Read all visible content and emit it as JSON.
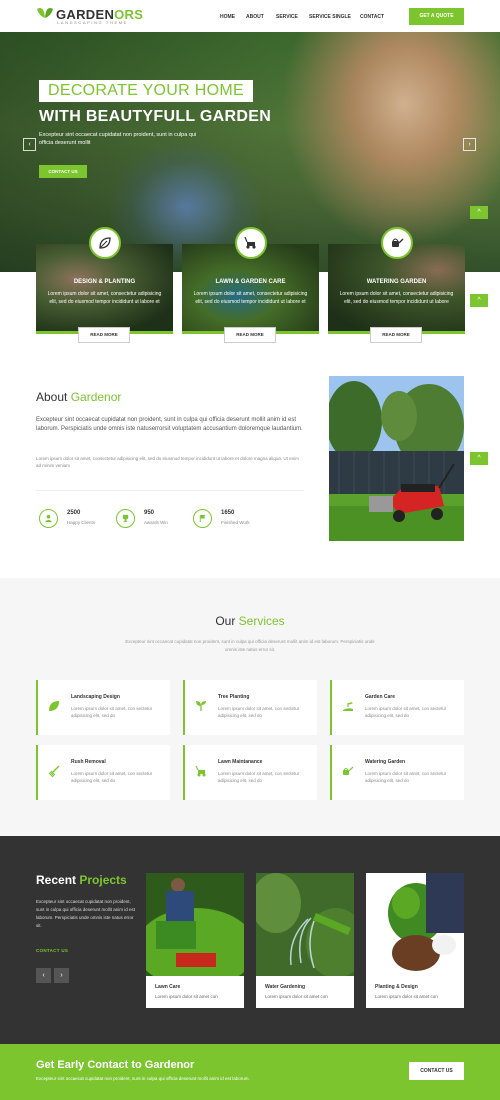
{
  "header": {
    "logo_main": "GARDEN",
    "logo_accent": "ORS",
    "logo_sub": "LANDSCAPING THEME",
    "nav": [
      "HOME",
      "ABOUT",
      "SERVICE",
      "SERVICE SINGLE",
      "CONTACT"
    ],
    "quote_button": "GET A QUOTE"
  },
  "hero": {
    "title_line1": "DECORATE YOUR HOME",
    "title_line2": "WITH BEAUTYFULL GARDEN",
    "text": "Excepteur sint occaecat cupidatat non proident, sunt in culpa qui officia deserunt mollit",
    "button": "CONTACT US",
    "prev_icon": "‹",
    "next_icon": "›"
  },
  "features": [
    {
      "title": "DESIGN & PLANTING",
      "text": "Lorem ipsum dolor sit amet, consectetur adipisicing elit, sed do eiusmod tempor incididunt ut labore et",
      "button": "READ MORE",
      "icon": "leaf-icon"
    },
    {
      "title": "LAWN & GARDEN CARE",
      "text": "Lorem ipsum dolor sit amet, consectetur adipisicing elit, sed do eiusmod tempor incididunt ut labore et",
      "button": "READ MORE",
      "icon": "lawnmower-icon"
    },
    {
      "title": "WATERING GARDEN",
      "text": "Lorem ipsum dolor sit amet, consectetur adipisicing elit, sed do eiusmod tempor incididunt ut labore",
      "button": "READ MORE",
      "icon": "watering-can-icon"
    }
  ],
  "about": {
    "title": "About ",
    "title_accent": "Gardenor",
    "lead": "Excepteur sint occaecat cupidatat non proident, sunt in culpa qui officia deserunt mollit anim id est laborum. Perspiciatis unde omnis iste natuserrorsit voluptatem accusantium doloremque laudantium.",
    "text": "Lorem ipsum dolor sit amet, consectetur adipisicing elit, sed do eiusmod tempor incididunt ut labore et dolore magna aliqua. Ut enim ad minim veniam",
    "stats": [
      {
        "number": "2500",
        "label": "Happy Clients",
        "icon": "user-icon"
      },
      {
        "number": "950",
        "label": "Awards Win",
        "icon": "trophy-icon"
      },
      {
        "number": "1650",
        "label": "Finished Work",
        "icon": "flag-icon"
      }
    ]
  },
  "services": {
    "title": "Our ",
    "title_accent": "Services",
    "subtitle": "Excepteur sint occaecat cupidatat non proident, sunt in culpa qui officia deserunt mollit anim id est laborum. Perspiciatis unde omnis iste natus error sit.",
    "items": [
      {
        "title": "Landscaping Design",
        "text": "Lorem ipsum dolor sit amet, con sectetur adipisicing elit, sed do",
        "icon": "leaf-icon"
      },
      {
        "title": "Tree Planting",
        "text": "Lorem ipsum dolor sit amet, con sectetur adipisicing elit, sed do",
        "icon": "sprout-icon"
      },
      {
        "title": "Garden Care",
        "text": "Lorem ipsum dolor sit amet, con sectetur adipisicing elit, sed do",
        "icon": "hand-plant-icon"
      },
      {
        "title": "Rush Removal",
        "text": "Lorem ipsum dolor sit amet, con sectetur adipisicing elit, sed do",
        "icon": "rake-icon"
      },
      {
        "title": "Lawn Maintanance",
        "text": "Lorem ipsum dolor sit amet, con sectetur adipisicing elit, sed do",
        "icon": "lawnmower-icon"
      },
      {
        "title": "Watering Garden",
        "text": "Lorem ipsum dolor sit amet, con sectetur adipisicing elit, sed do",
        "icon": "watering-can-icon"
      }
    ]
  },
  "projects": {
    "title": "Recent ",
    "title_accent": "Projects",
    "text": "Excepteur sint occaecat cupidatat non proident, sunt in culpa qui officia deserunt mollit anim id est laborum. Perspiciatis unde omnis iste natus error sit.",
    "link": "CONTACT US",
    "prev_icon": "‹",
    "next_icon": "›",
    "items": [
      {
        "title": "Lawn Care",
        "text": "Lorem ipsum dolor sit amet con"
      },
      {
        "title": "Water Gardening",
        "text": "Lorem ipsum dolor sit amet con"
      },
      {
        "title": "Planting & Design",
        "text": "Lorem ipsum dolor sit amet con"
      }
    ]
  },
  "cta": {
    "title": "Get Early Contact to Gardenor",
    "text": "Excepteur sint occaecat cupidatat non proident, sunt in culpa qui officia deserunt mollit anim id est laborum.",
    "button": "CONTACT US"
  },
  "side_tab_icon": "^",
  "colors": {
    "accent": "#7cc52f",
    "dark": "#333333",
    "light_bg": "#f6f6f6"
  }
}
